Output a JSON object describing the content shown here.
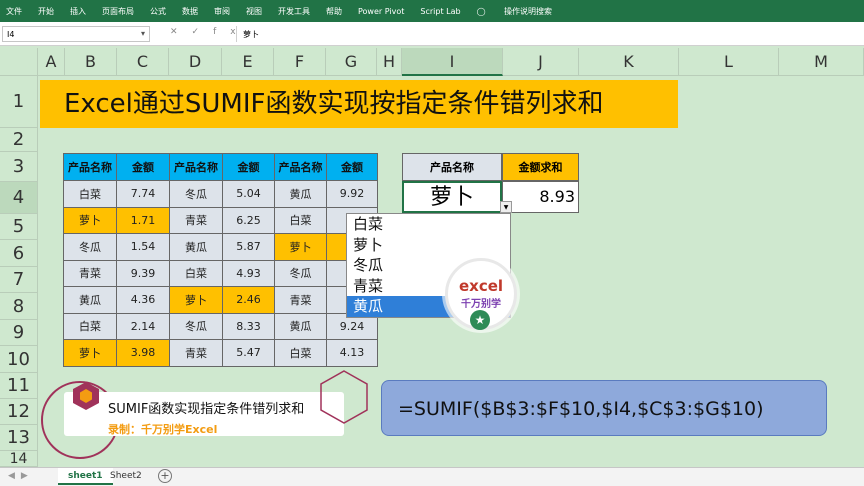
{
  "ribbon": {
    "tabs": [
      "文件",
      "开始",
      "插入",
      "页面布局",
      "公式",
      "数据",
      "审阅",
      "视图",
      "开发工具",
      "帮助",
      "Power Pivot",
      "Script Lab"
    ],
    "tell_me": "操作说明搜索"
  },
  "formula_bar": {
    "name_box": "I4",
    "content": "萝卜"
  },
  "columns": [
    "A",
    "B",
    "C",
    "D",
    "E",
    "F",
    "G",
    "H",
    "I",
    "J",
    "K",
    "L",
    "M"
  ],
  "rows": [
    "1",
    "2",
    "3",
    "4",
    "5",
    "6",
    "7",
    "8",
    "9",
    "10",
    "11",
    "12",
    "13",
    "14"
  ],
  "title": "Excel通过SUMIF函数实现按指定条件错列求和",
  "table": {
    "headers": [
      "产品名称",
      "金额",
      "产品名称",
      "金额",
      "产品名称",
      "金额"
    ],
    "rows": [
      [
        "白菜",
        "7.74",
        "冬瓜",
        "5.04",
        "黄瓜",
        "9.92"
      ],
      [
        "萝卜",
        "1.71",
        "青菜",
        "6.25",
        "白菜",
        ""
      ],
      [
        "冬瓜",
        "1.54",
        "黄瓜",
        "5.87",
        "萝卜",
        ""
      ],
      [
        "青菜",
        "9.39",
        "白菜",
        "4.93",
        "冬瓜",
        ""
      ],
      [
        "黄瓜",
        "4.36",
        "萝卜",
        "2.46",
        "青菜",
        ""
      ],
      [
        "白菜",
        "2.14",
        "冬瓜",
        "8.33",
        "黄瓜",
        "9.24"
      ],
      [
        "萝卜",
        "3.98",
        "青菜",
        "5.47",
        "白菜",
        "4.13"
      ]
    ]
  },
  "lookup": {
    "name_header": "产品名称",
    "sum_header": "金额求和",
    "name_value": "萝卜",
    "sum_value": "8.93"
  },
  "dropdown": {
    "options": [
      "白菜",
      "萝卜",
      "冬瓜",
      "青菜",
      "黄瓜"
    ],
    "selected_index": 4
  },
  "badge": {
    "line1": "excel",
    "line2": "千万别学"
  },
  "formula_display": "=SUMIF($B$3:$F$10,$I4,$C$3:$G$10)",
  "caption": {
    "main": "SUMIF函数实现指定条件错列求和",
    "sub": "录制：千万别学Excel"
  },
  "sheets": [
    "sheet1",
    "Sheet2"
  ],
  "colors": {
    "ribbon": "#217346",
    "banner": "#ffc000",
    "header_blue": "#00b0f0",
    "highlight": "#ffc000",
    "formula_box": "#8ea9db",
    "dropdown_selected": "#2f7fd8"
  }
}
